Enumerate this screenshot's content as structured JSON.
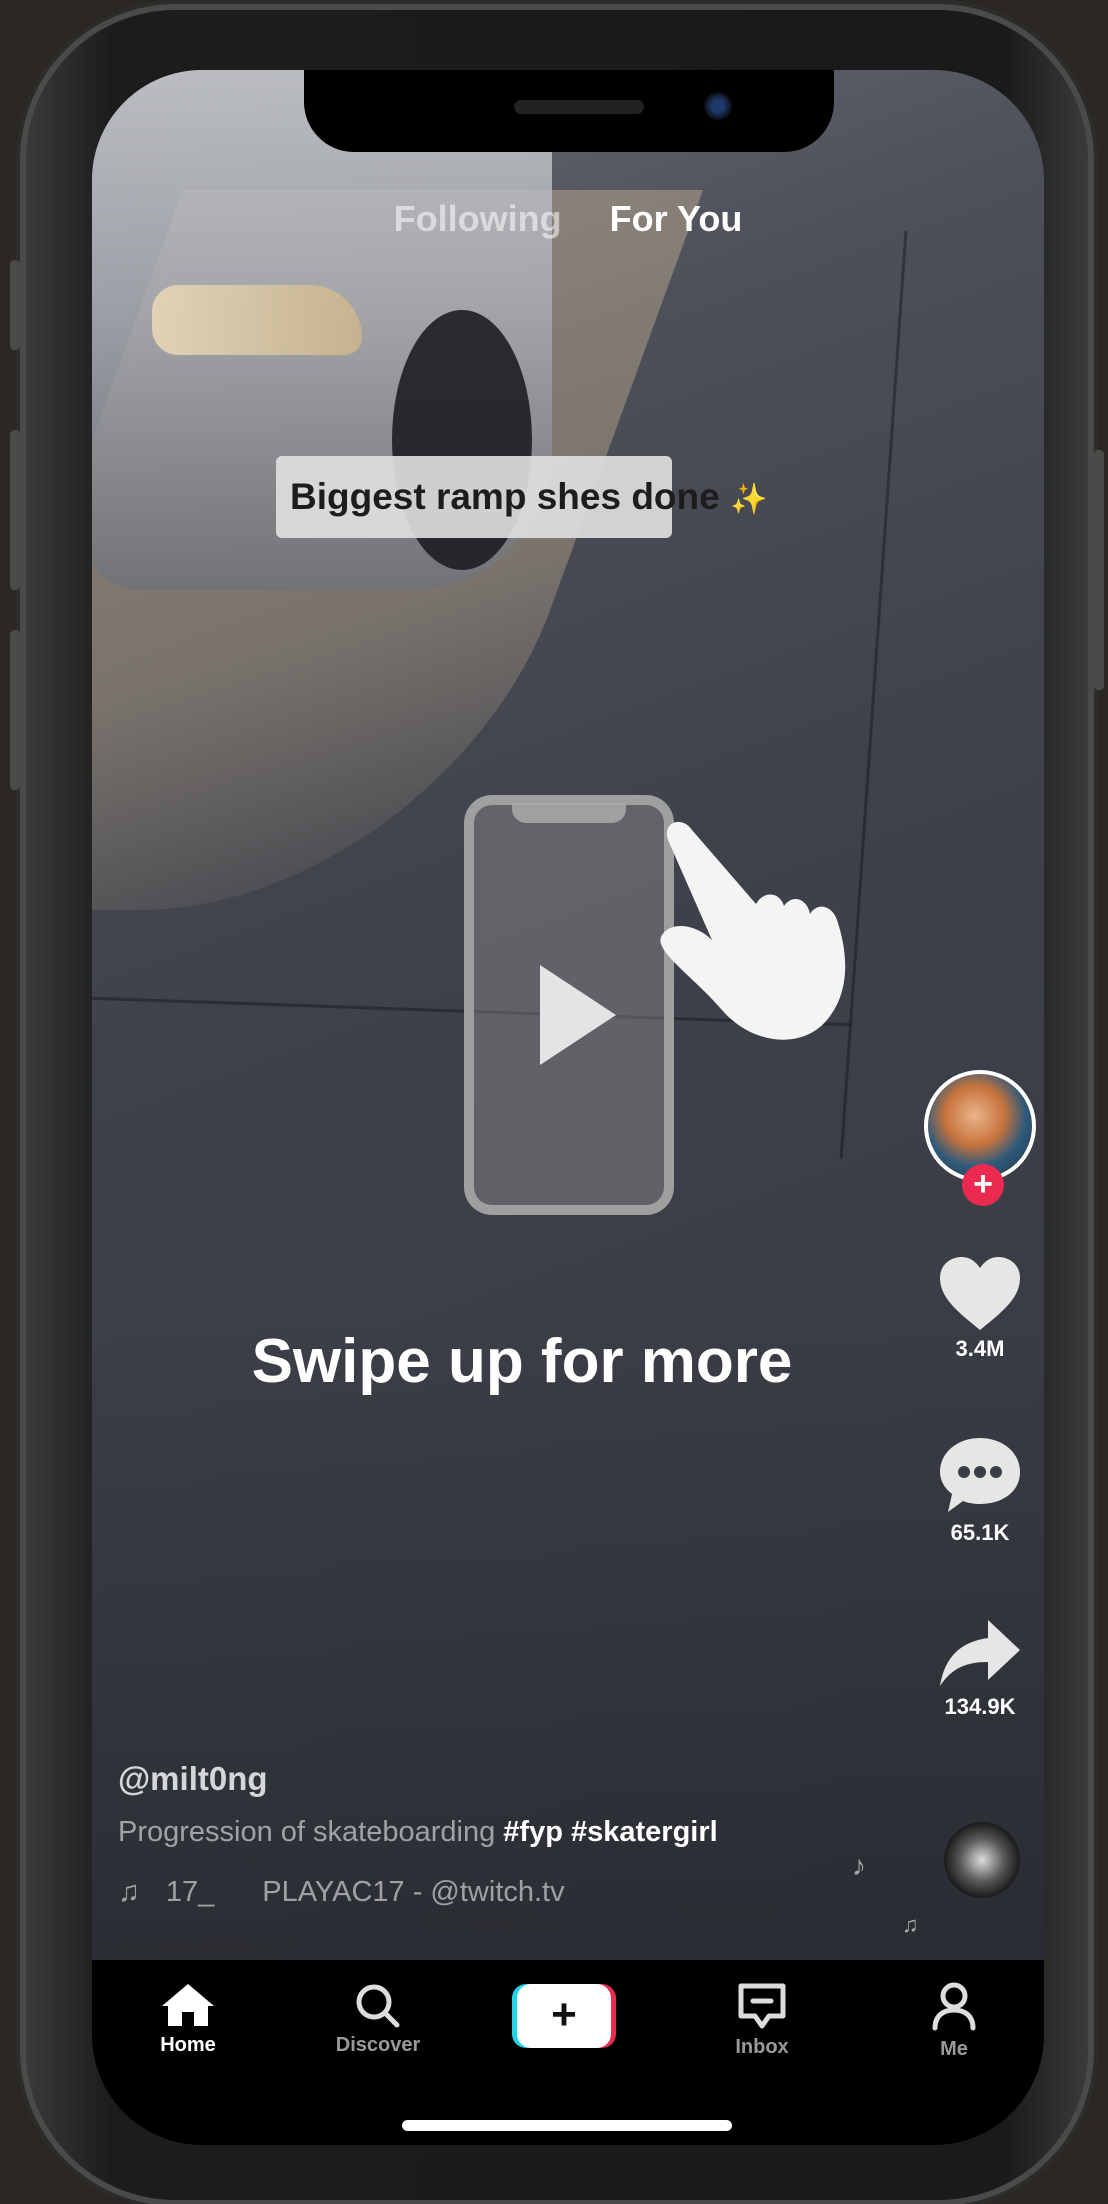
{
  "top_tabs": {
    "following": "Following",
    "for_you": "For You"
  },
  "video": {
    "caption": "Biggest ramp shes done",
    "tutorial_text": "Swipe up for more"
  },
  "actions": {
    "likes": "3.4M",
    "comments": "65.1K",
    "shares": "134.9K"
  },
  "info": {
    "username": "@milt0ng",
    "description": "Progression of skateboarding",
    "hashtags": "#fyp #skatergirl",
    "sound_prefix": "17_",
    "sound_name": "PLAYAC17 - @twitch.tv"
  },
  "nav": {
    "home": "Home",
    "discover": "Discover",
    "inbox": "Inbox",
    "me": "Me",
    "create": "+"
  },
  "colors": {
    "accent_red": "#ea2a4f",
    "create_cyan": "#22d3e6",
    "create_pink": "#ea2a4f"
  },
  "icons": [
    "heart-icon",
    "comment-icon",
    "share-icon",
    "music-note-icon",
    "home-icon",
    "search-icon",
    "inbox-icon",
    "profile-icon",
    "play-icon",
    "hand-pointer-icon"
  ]
}
